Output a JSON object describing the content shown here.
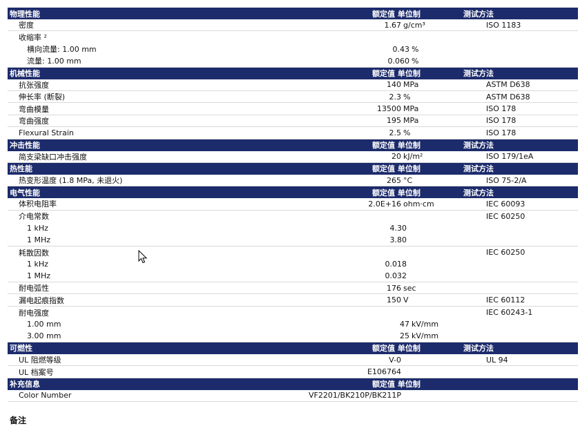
{
  "sections": [
    {
      "title": "物理性能",
      "col_value": "额定值 单位制",
      "col_method": "测试方法",
      "rows": [
        {
          "name": "密度",
          "value": "1.67",
          "unit": "g/cm³",
          "method": "ISO 1183",
          "indent": 0
        },
        {
          "name": "收缩率 ²",
          "value": "",
          "unit": "",
          "method": "",
          "indent": 0,
          "sub": true
        },
        {
          "name": "横向流量: 1.00 mm",
          "value": "0.43",
          "unit": "%",
          "method": "",
          "indent": 1,
          "sub": true
        },
        {
          "name": "流量: 1.00 mm",
          "value": "0.060",
          "unit": "%",
          "method": "",
          "indent": 1
        }
      ]
    },
    {
      "title": "机械性能",
      "col_value": "额定值 单位制",
      "col_method": "测试方法",
      "rows": [
        {
          "name": "抗张强度",
          "value": "140",
          "unit": "MPa",
          "method": "ASTM D638",
          "indent": 0
        },
        {
          "name": "伸长率 (断裂)",
          "value": "2.3",
          "unit": "%",
          "method": "ASTM D638",
          "indent": 0
        },
        {
          "name": "弯曲模量",
          "value": "13500",
          "unit": "MPa",
          "method": "ISO 178",
          "indent": 0
        },
        {
          "name": "弯曲强度",
          "value": "195",
          "unit": "MPa",
          "method": "ISO 178",
          "indent": 0
        },
        {
          "name": "Flexural Strain",
          "value": "2.5",
          "unit": "%",
          "method": "ISO 178",
          "indent": 0
        }
      ]
    },
    {
      "title": "冲击性能",
      "col_value": "额定值 单位制",
      "col_method": "测试方法",
      "rows": [
        {
          "name": "简支梁缺口冲击强度",
          "value": "20",
          "unit": "kJ/m²",
          "method": "ISO 179/1eA",
          "indent": 0
        }
      ]
    },
    {
      "title": "热性能",
      "col_value": "额定值 单位制",
      "col_method": "测试方法",
      "rows": [
        {
          "name": "热变形温度 (1.8 MPa, 未退火)",
          "value": "265",
          "unit": "°C",
          "method": "ISO 75-2/A",
          "indent": 0
        }
      ]
    },
    {
      "title": "电气性能",
      "col_value": "额定值 单位制",
      "col_method": "测试方法",
      "rows": [
        {
          "name": "体积电阻率",
          "value": "2.0E+16",
          "unit": "ohm·cm",
          "method": "IEC 60093",
          "indent": 0
        },
        {
          "name": "介电常数",
          "value": "",
          "unit": "",
          "method": "IEC 60250",
          "indent": 0,
          "sub": true
        },
        {
          "name": "1 kHz",
          "value": "4.30",
          "unit": "",
          "method": "",
          "indent": 1,
          "sub": true
        },
        {
          "name": "1 MHz",
          "value": "3.80",
          "unit": "",
          "method": "",
          "indent": 1
        },
        {
          "name": "耗散因数",
          "value": "",
          "unit": "",
          "method": "IEC 60250",
          "indent": 0,
          "sub": true
        },
        {
          "name": "1 kHz",
          "value": "0.018",
          "unit": "",
          "method": "",
          "indent": 1,
          "sub": true
        },
        {
          "name": "1 MHz",
          "value": "0.032",
          "unit": "",
          "method": "",
          "indent": 1
        },
        {
          "name": "耐电弧性",
          "value": "176",
          "unit": "sec",
          "method": "",
          "indent": 0
        },
        {
          "name": "漏电起痕指数",
          "value": "150",
          "unit": "V",
          "method": "IEC 60112",
          "indent": 0
        },
        {
          "name": "耐电强度",
          "value": "",
          "unit": "",
          "method": "IEC 60243-1",
          "indent": 0,
          "sub": true
        },
        {
          "name": "1.00 mm",
          "value": "47",
          "unit": "kV/mm",
          "method": "",
          "indent": 1,
          "sub": true
        },
        {
          "name": "3.00 mm",
          "value": "25",
          "unit": "kV/mm",
          "method": "",
          "indent": 1
        }
      ]
    },
    {
      "title": "可燃性",
      "col_value": "额定值 单位制",
      "col_method": "测试方法",
      "rows": [
        {
          "name": "UL 阻燃等级",
          "value": "V-0",
          "unit": "",
          "method": "UL 94",
          "indent": 0
        },
        {
          "name": "UL 档案号",
          "value": "E106764",
          "unit": "",
          "method": "",
          "indent": 0
        }
      ]
    },
    {
      "title": "补充信息",
      "col_value": "额定值 单位制",
      "col_method": "",
      "rows": [
        {
          "name": "Color Number",
          "value": "VF2201/BK210P/BK211P",
          "unit": "",
          "method": "",
          "indent": 0,
          "wide": true
        }
      ]
    }
  ],
  "notes_title": "备注",
  "colors": {
    "header_bg": "#1c2b6b",
    "header_text": "#ffffff",
    "row_border": "#d9d9d9"
  },
  "cursor_icon": "mouse-pointer-icon"
}
